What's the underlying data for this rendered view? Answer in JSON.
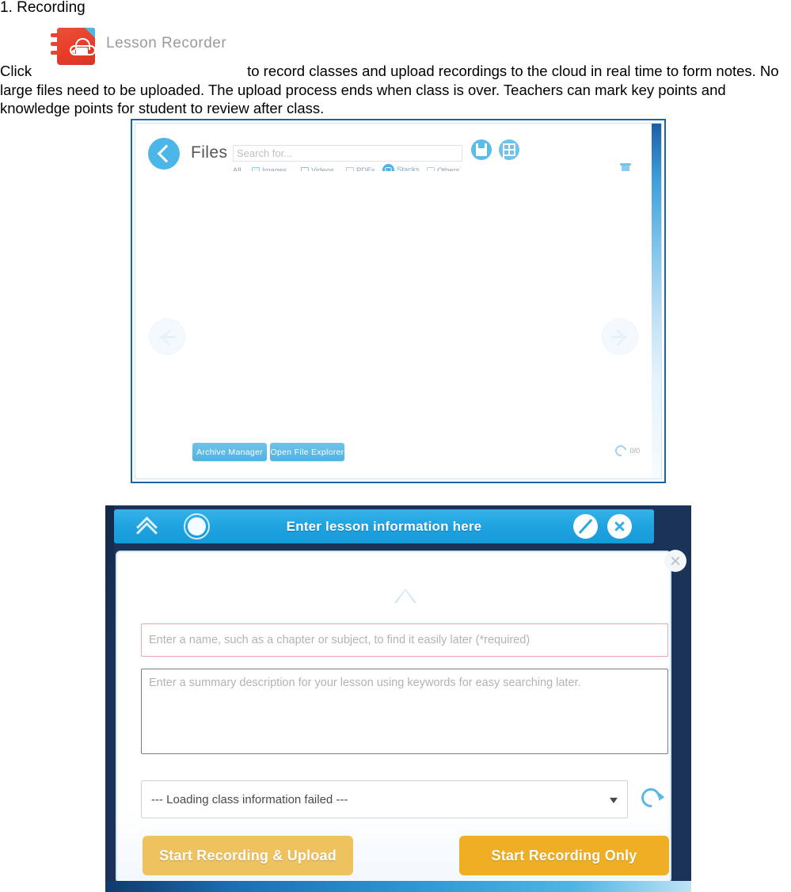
{
  "document": {
    "heading": "1. Recording",
    "paragraph_before": "Click",
    "paragraph_after": "to record classes and upload recordings to the cloud in real time to form notes. No large files need to be uploaded. The upload process ends when class is over. Teachers can mark key points and knowledge points for student to review after class.",
    "lesson_recorder_label": "Lesson Recorder"
  },
  "files_window": {
    "title": "Files",
    "search_placeholder": "Search for...",
    "filters": [
      {
        "label": "All",
        "icon": "none",
        "active": false
      },
      {
        "label": "Images",
        "icon": "image-icon",
        "active": false
      },
      {
        "label": "Videos",
        "icon": "video-icon",
        "active": false
      },
      {
        "label": "PDFs",
        "icon": "pdf-icon",
        "active": false
      },
      {
        "label": "Stacks",
        "icon": "stacks-icon",
        "active": true
      },
      {
        "label": "Others",
        "icon": "others-icon",
        "active": false
      }
    ],
    "header_icons": [
      "save-icon",
      "grid-view-icon"
    ],
    "window_controls": [
      "maximize-icon",
      "close-icon"
    ],
    "trash_icon": "trash-icon",
    "nav_prev_icon": "arrow-left-icon",
    "nav_next_icon": "arrow-right-icon",
    "footer": {
      "archive_button": "Archive Manager",
      "explorer_button": "Open File Explorer",
      "sync_icon": "sync-icon",
      "sync_count": "0/0"
    }
  },
  "lesson_dialog": {
    "title": "Enter lesson information here",
    "header_icons": [
      "chevron-up-icon",
      "record-circle-icon",
      "pen-icon",
      "close-icon"
    ],
    "side_close_icon": "close-icon",
    "name_placeholder": "Enter a name, such as a chapter or subject, to find it easily later  (*required)",
    "description_placeholder": "Enter a summary description for your lesson using keywords for easy searching later.",
    "class_select_value": "--- Loading class information failed ---",
    "reload_icon": "reload-icon",
    "buttons": {
      "upload": "Start Recording & Upload",
      "only": "Start Recording Only"
    },
    "colors": {
      "header_blue": "#1fa3e0",
      "frame_navy": "#1b3358",
      "button_upload": "#efc260",
      "button_only": "#f0ae24",
      "required_border": "#e8a9a9"
    }
  }
}
